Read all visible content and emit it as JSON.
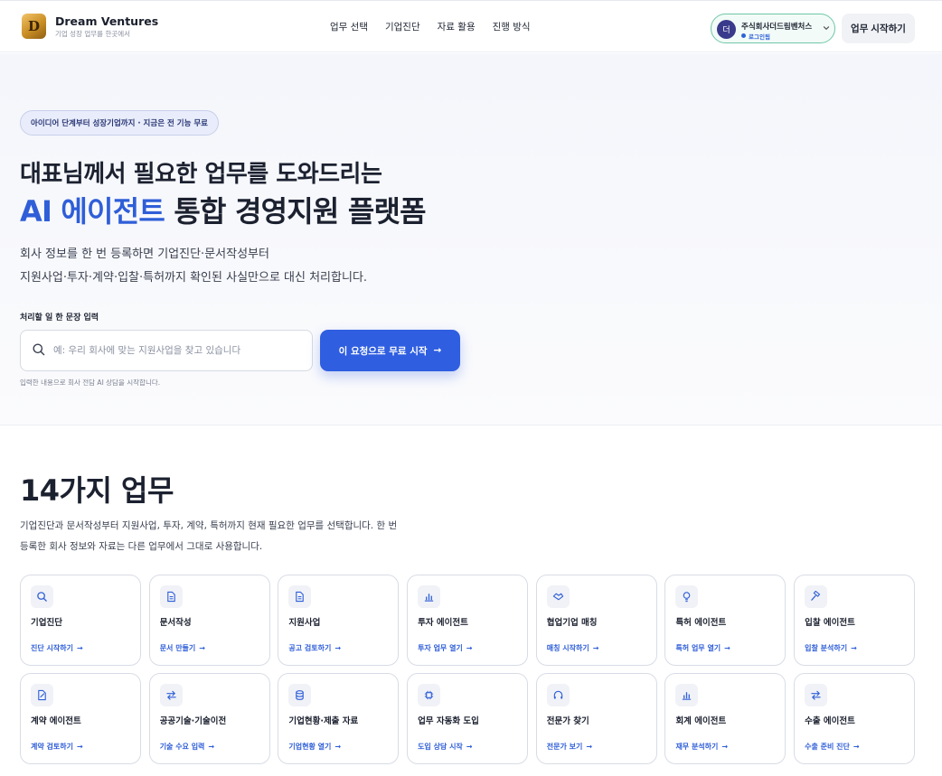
{
  "header": {
    "logo_letter": "D",
    "brand_name": "Dream Ventures",
    "brand_tagline": "기업 성장 업무를 한곳에서",
    "nav": [
      "업무 선택",
      "기업진단",
      "자료 활용",
      "진행 방식"
    ],
    "account": {
      "avatar_initial": "더",
      "company_name": "주식회사더드림벤처스",
      "status": "로그인됨",
      "chevron_icon": "chevron-down-icon"
    },
    "start_button": "업무 시작하기"
  },
  "hero": {
    "badge": "아이디어 단계부터 성장기업까지 · 지금은 전 기능 무료",
    "headline_line1": "대표님께서 필요한 업무를 도와드리는",
    "headline_accent": "AI 에이전트",
    "headline_rest": " 통합 경영지원 플랫폼",
    "desc_line1": "회사 정보를 한 번 등록하면 기업진단·문서작성부터",
    "desc_line2": "지원사업·투자·계약·입찰·특허까지 확인된 사실만으로 대신 처리합니다.",
    "input_label": "처리할 일 한 문장 입력",
    "input_placeholder": "예: 우리 회사에 맞는 지원사업을 찾고 있습니다",
    "input_value": "",
    "cta_label": "이 요청으로 무료 시작",
    "cta_arrow": "→",
    "hint": "입력한 내용으로 회사 전담 AI 상담을 시작합니다."
  },
  "services": {
    "title": "14가지 업무",
    "desc_line1": "기업진단과 문서작성부터 지원사업, 투자, 계약, 특허까지 현재 필요한 업무를 선택합니다. 한 번",
    "desc_line2": "등록한 회사 정보와 자료는 다른 업무에서 그대로 사용합니다.",
    "cards": [
      {
        "title": "기업진단",
        "link": "진단 시작하기",
        "icon": "search-icon"
      },
      {
        "title": "문서작성",
        "link": "문서 만들기",
        "icon": "document-icon"
      },
      {
        "title": "지원사업",
        "link": "공고 검토하기",
        "icon": "document-icon"
      },
      {
        "title": "투자 에이전트",
        "link": "투자 업무 열기",
        "icon": "bar-chart-icon"
      },
      {
        "title": "협업기업 매칭",
        "link": "매칭 시작하기",
        "icon": "handshake-icon"
      },
      {
        "title": "특허 에이전트",
        "link": "특허 업무 열기",
        "icon": "lightbulb-icon"
      },
      {
        "title": "입찰 에이전트",
        "link": "입찰 분석하기",
        "icon": "gavel-icon"
      },
      {
        "title": "계약 에이전트",
        "link": "계약 검토하기",
        "icon": "contract-icon"
      },
      {
        "title": "공공기술·기술이전",
        "link": "기술 수요 입력",
        "icon": "transfer-icon"
      },
      {
        "title": "기업현황·제출 자료",
        "link": "기업현황 열기",
        "icon": "database-icon"
      },
      {
        "title": "업무 자동화 도입",
        "link": "도입 상담 시작",
        "icon": "chip-icon"
      },
      {
        "title": "전문가 찾기",
        "link": "전문가 보기",
        "icon": "headset-icon"
      },
      {
        "title": "회계 에이전트",
        "link": "재무 분석하기",
        "icon": "bar-chart-icon"
      },
      {
        "title": "수출 에이전트",
        "link": "수출 준비 진단",
        "icon": "transfer-icon"
      }
    ],
    "link_arrow": "→"
  },
  "colors": {
    "accent": "#2f5ee0",
    "account_border": "#6fc7a7",
    "pill_background": "#e9edfb"
  }
}
